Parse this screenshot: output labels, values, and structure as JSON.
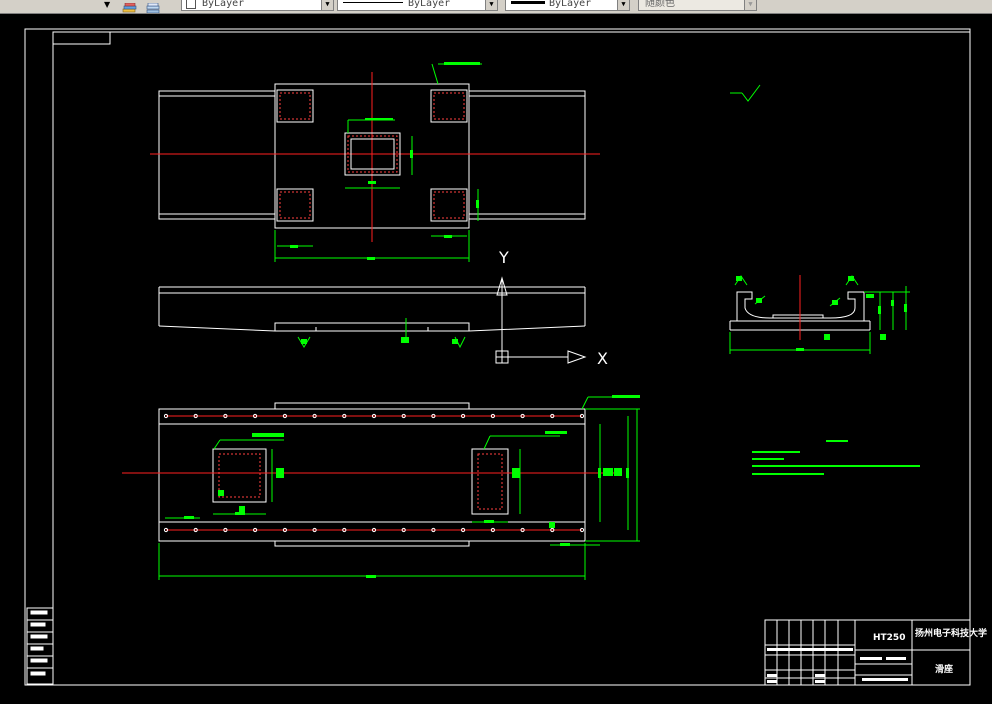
{
  "toolbar": {
    "layer_dropdown_icon": "chevron-down-icon",
    "icons": [
      "layer-states-icon",
      "layer-previous-icon"
    ],
    "color_combo": {
      "value": "ByLayer"
    },
    "linetype_combo": {
      "value": "ByLayer"
    },
    "lineweight_combo": {
      "value": "ByLayer"
    },
    "plotstyle_combo": {
      "value": "随颜色"
    }
  },
  "ucs": {
    "y_label": "Y",
    "x_label": "X"
  },
  "title_block": {
    "drawing_code": "HT250",
    "school": "扬州电子科技大学",
    "part_name": "滑座"
  },
  "colors": {
    "background": "#000000",
    "border": "#ffffff",
    "centerline": "#ff2020",
    "dimension": "#00ff00",
    "hole": "#ff4040"
  }
}
